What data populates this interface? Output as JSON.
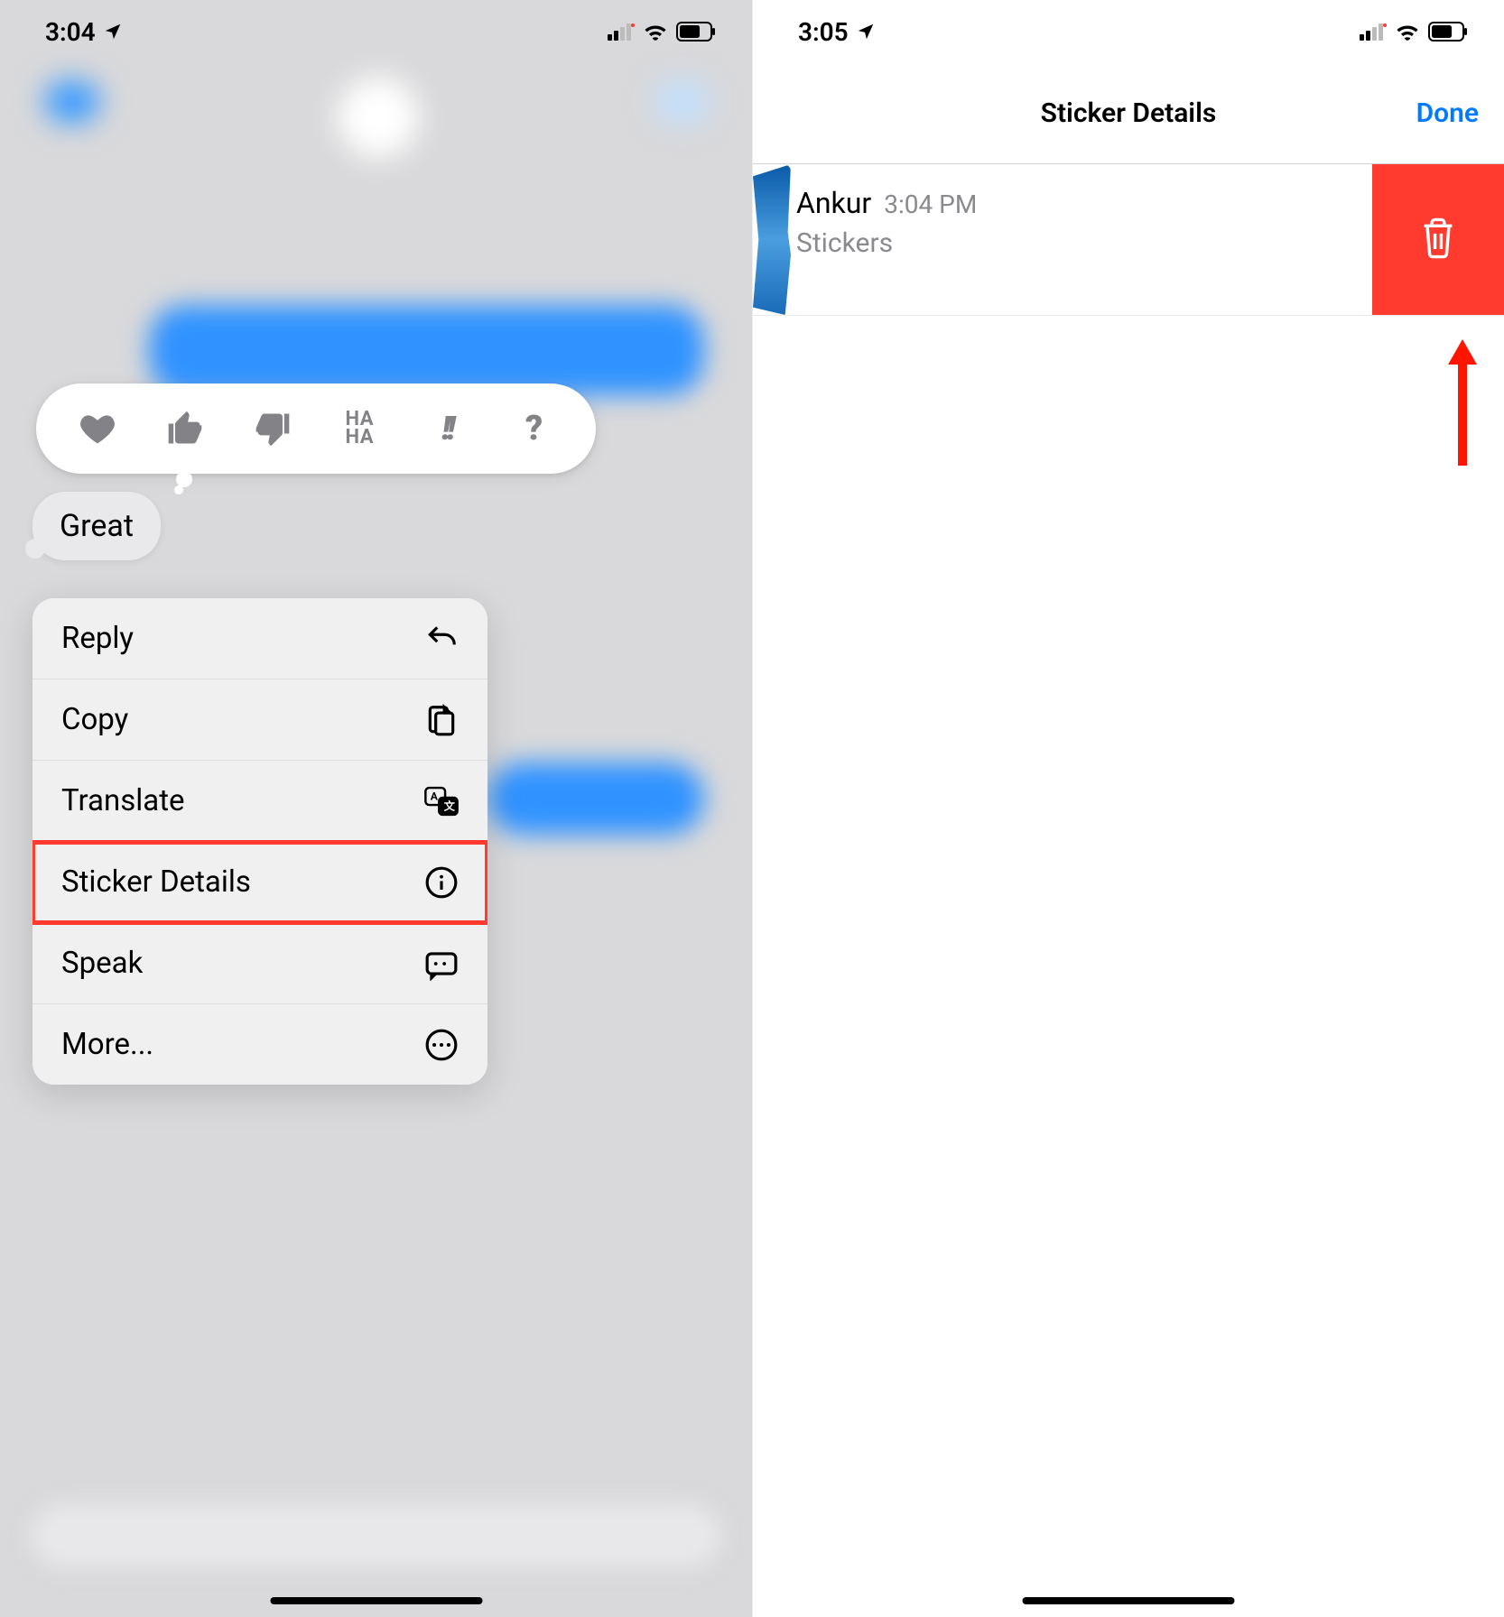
{
  "left": {
    "status": {
      "time": "3:04"
    },
    "message": "Great",
    "menu": {
      "reply": "Reply",
      "copy": "Copy",
      "translate": "Translate",
      "sticker_details": "Sticker Details",
      "speak": "Speak",
      "more": "More..."
    }
  },
  "right": {
    "status": {
      "time": "3:05"
    },
    "nav": {
      "title": "Sticker Details",
      "done": "Done"
    },
    "row": {
      "name": "Ankur",
      "time": "3:04 PM",
      "sub": "Stickers"
    }
  }
}
